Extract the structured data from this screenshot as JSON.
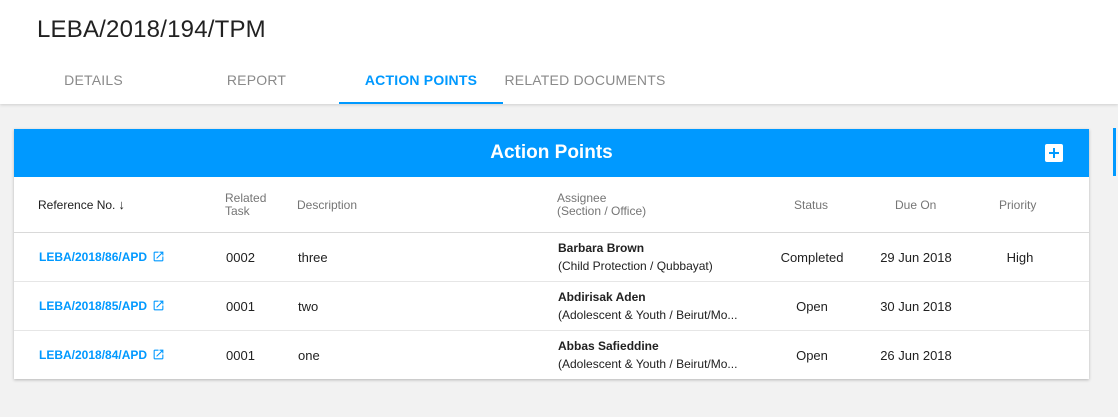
{
  "page": {
    "title": "LEBA/2018/194/TPM"
  },
  "tabs": [
    {
      "label": "DETAILS"
    },
    {
      "label": "REPORT"
    },
    {
      "label": "ACTION POINTS"
    },
    {
      "label": "RELATED DOCUMENTS"
    }
  ],
  "card": {
    "title": "Action Points"
  },
  "table": {
    "headers": {
      "reference": "Reference No.",
      "related_task_1": "Related",
      "related_task_2": "Task",
      "description": "Description",
      "assignee_1": "Assignee",
      "assignee_2": "(Section / Office)",
      "status": "Status",
      "due_on": "Due On",
      "priority": "Priority"
    },
    "rows": [
      {
        "reference": "LEBA/2018/86/APD",
        "related_task": "0002",
        "description": "three",
        "assignee_name": "Barbara Brown",
        "assignee_section": "(Child Protection / Qubbayat)",
        "status": "Completed",
        "due_on": "29 Jun 2018",
        "priority": "High"
      },
      {
        "reference": "LEBA/2018/85/APD",
        "related_task": "0001",
        "description": "two",
        "assignee_name": "Abdirisak Aden",
        "assignee_section": "(Adolescent & Youth / Beirut/Mo...",
        "status": "Open",
        "due_on": "30 Jun 2018",
        "priority": ""
      },
      {
        "reference": "LEBA/2018/84/APD",
        "related_task": "0001",
        "description": "one",
        "assignee_name": "Abbas Safieddine",
        "assignee_section": "(Adolescent & Youth / Beirut/Mo...",
        "status": "Open",
        "due_on": "26 Jun 2018",
        "priority": ""
      }
    ]
  },
  "icons": {
    "add": "add-box-icon",
    "sort": "arrow-down-icon",
    "external": "open-in-new-icon"
  },
  "colors": {
    "accent": "#0099ff",
    "tab_inactive": "#8a8a8a",
    "background": "#f2f2f2"
  }
}
